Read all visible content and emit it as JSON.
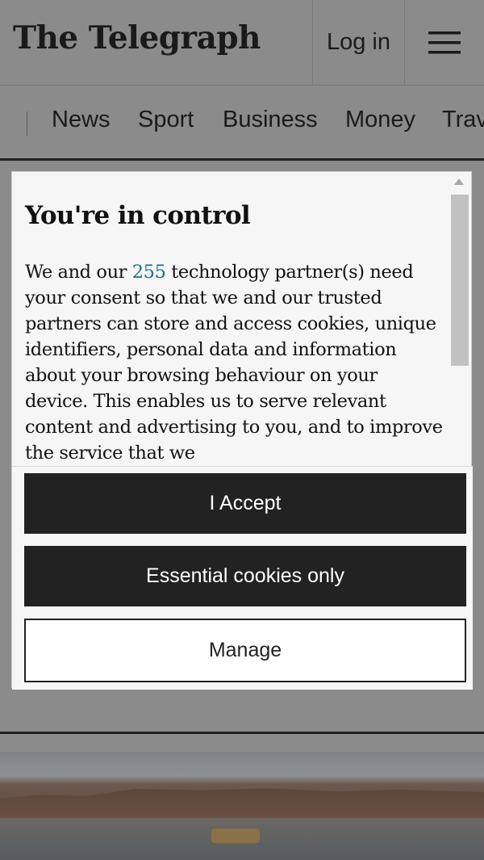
{
  "header": {
    "logo": "The Telegraph",
    "login_label": "Log in",
    "menu_icon": "hamburger-menu-icon"
  },
  "nav": {
    "items": [
      "News",
      "Sport",
      "Business",
      "Money",
      "Trav"
    ]
  },
  "consent": {
    "title": "You're in control",
    "body_before": "We and our ",
    "partner_count": "255",
    "body_after": " technology partner(s) need your consent so that we and our trusted partners can store and access cookies, unique identifiers, personal data and information about your browsing behaviour on your device. This enables us to serve relevant content and advertising to you, and to improve the service that we",
    "accept_label": "I Accept",
    "essential_label": "Essential cookies only",
    "manage_label": "Manage",
    "link_color": "#1d6e86"
  }
}
